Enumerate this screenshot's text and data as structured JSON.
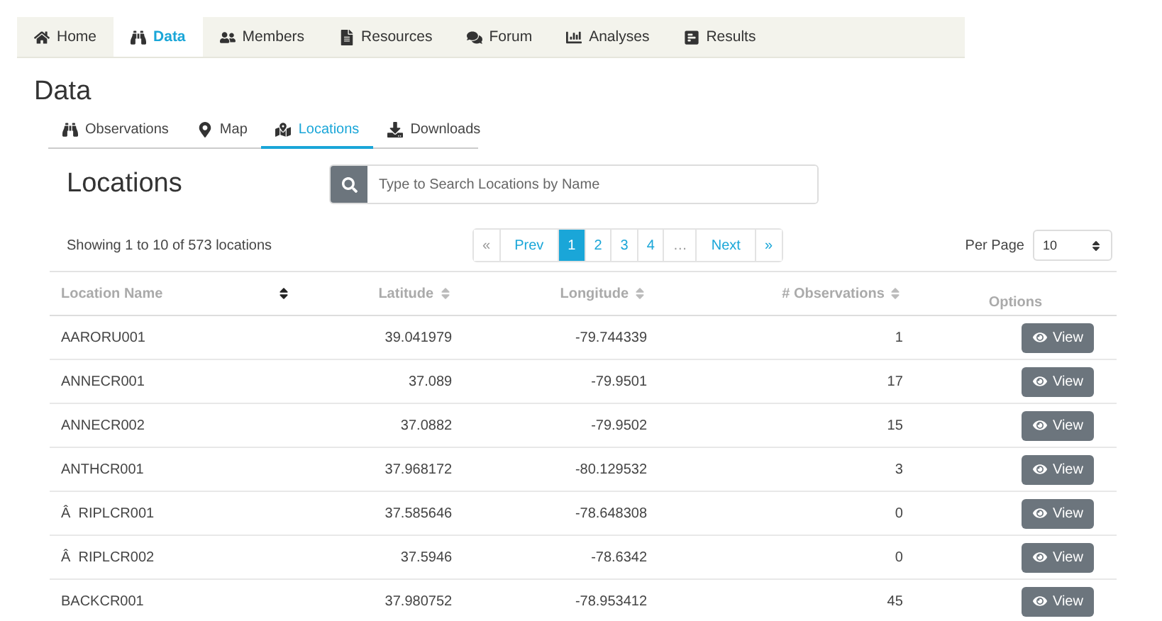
{
  "nav_tabs": [
    {
      "label": "Home",
      "selected": false
    },
    {
      "label": "Data",
      "selected": true
    },
    {
      "label": "Members",
      "selected": false
    },
    {
      "label": "Resources",
      "selected": false
    },
    {
      "label": "Forum",
      "selected": false
    },
    {
      "label": "Analyses",
      "selected": false
    },
    {
      "label": "Results",
      "selected": false
    }
  ],
  "page_title": "Data",
  "sub_tabs": [
    {
      "label": "Observations",
      "selected": false
    },
    {
      "label": "Map",
      "selected": false
    },
    {
      "label": "Locations",
      "selected": true
    },
    {
      "label": "Downloads",
      "selected": false
    }
  ],
  "section_title": "Locations",
  "search": {
    "placeholder": "Type to Search Locations by Name"
  },
  "summary": "Showing 1 to 10 of 573 locations",
  "pagination": [
    {
      "label": "«",
      "selected": false
    },
    {
      "label": "Prev",
      "selected": false
    },
    {
      "label": "1",
      "selected": true
    },
    {
      "label": "2",
      "selected": false
    },
    {
      "label": "3",
      "selected": false
    },
    {
      "label": "4",
      "selected": false
    },
    {
      "label": "…",
      "selected": false
    },
    {
      "label": "Next",
      "selected": false
    },
    {
      "label": "»",
      "selected": false
    }
  ],
  "per_page": {
    "label": "Per Page",
    "value": "10"
  },
  "table": {
    "columns": [
      "Location Name",
      "Latitude",
      "Longitude",
      "# Observations",
      "Options"
    ],
    "rows": [
      {
        "name": "AARORU001",
        "latitude": "39.041979",
        "longitude": "-79.744339",
        "observations": "1",
        "action": "View"
      },
      {
        "name": "ANNECR001",
        "latitude": "37.089",
        "longitude": "-79.9501",
        "observations": "17",
        "action": "View"
      },
      {
        "name": "ANNECR002",
        "latitude": "37.0882",
        "longitude": "-79.9502",
        "observations": "15",
        "action": "View"
      },
      {
        "name": "ANTHCR001",
        "latitude": "37.968172",
        "longitude": "-80.129532",
        "observations": "3",
        "action": "View"
      },
      {
        "name": "Â  RIPLCR001",
        "latitude": "37.585646",
        "longitude": "-78.648308",
        "observations": "0",
        "action": "View"
      },
      {
        "name": "Â  RIPLCR002",
        "latitude": "37.5946",
        "longitude": "-78.6342",
        "observations": "0",
        "action": "View"
      },
      {
        "name": "BACKCR001",
        "latitude": "37.980752",
        "longitude": "-78.953412",
        "observations": "45",
        "action": "View"
      }
    ]
  }
}
